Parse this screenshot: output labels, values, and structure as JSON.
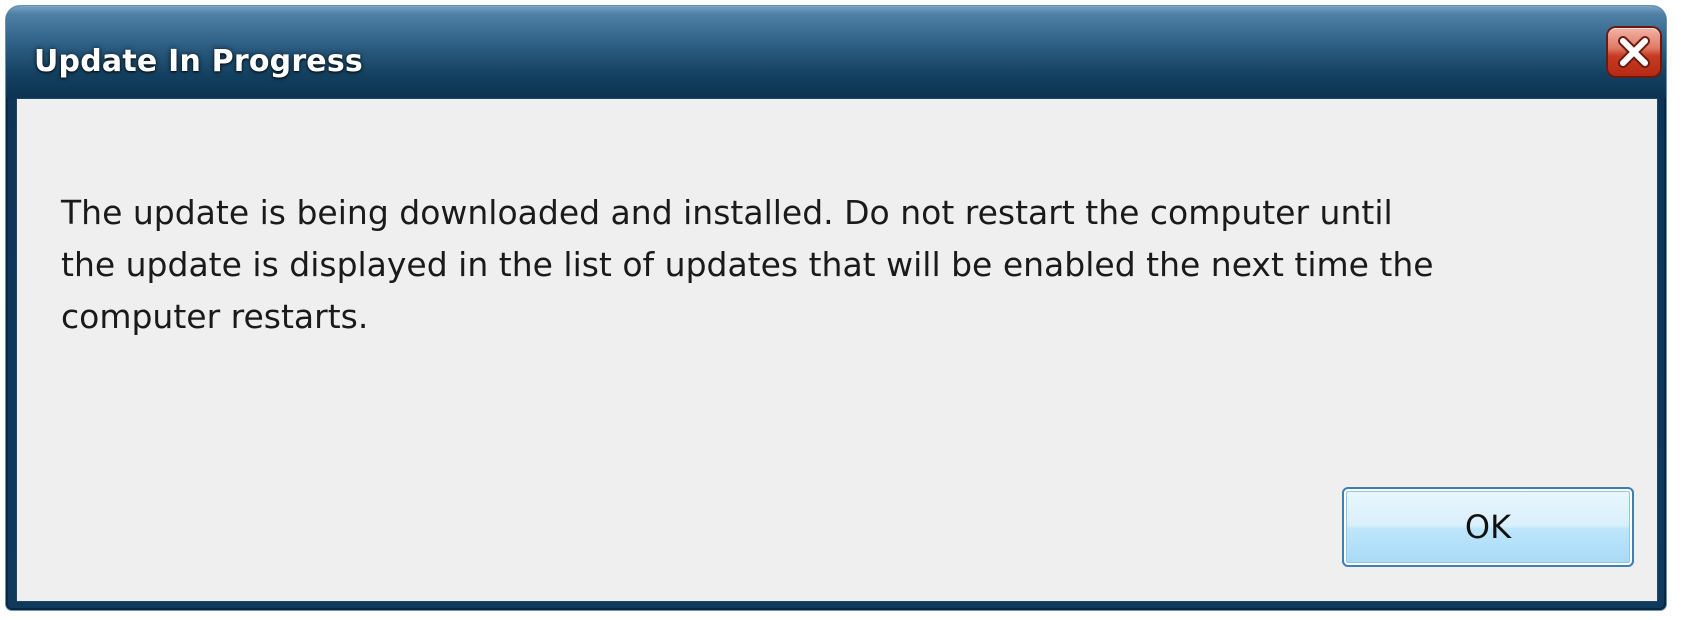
{
  "window": {
    "title": "Update In Progress",
    "close_icon": "close-x-icon"
  },
  "body": {
    "message": "The update is being downloaded and installed. Do not restart the computer until\nthe update is displayed in the list of updates that will be enabled the next time the\ncomputer restarts."
  },
  "buttons": {
    "ok_label": "OK"
  },
  "colors": {
    "titlebar": "#1b4a6e",
    "client_background": "#efefef",
    "close_button": "#c73a22",
    "button_border": "#3c7fb1"
  }
}
